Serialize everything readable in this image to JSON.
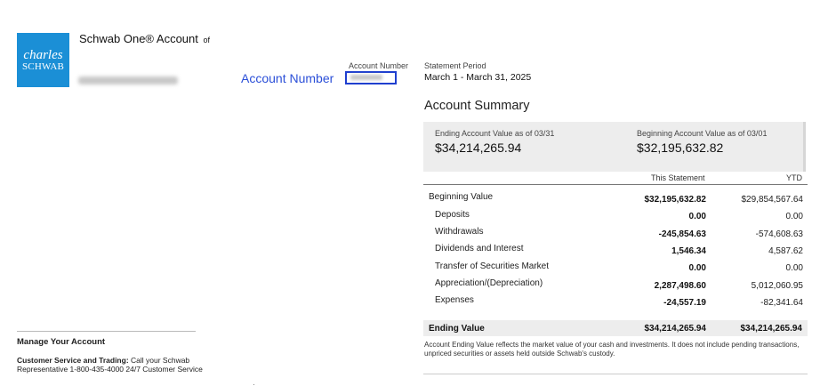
{
  "brand": {
    "logo_line1": "charles",
    "logo_line2": "SCHWAB",
    "logo_color": "#1b8fd6"
  },
  "account": {
    "title": "Schwab One® Account",
    "of": "of",
    "number_label_large": "Account Number",
    "number_label_small": "Account Number"
  },
  "statement": {
    "period_label": "Statement Period",
    "period_value": "March 1 - March 31, 2025"
  },
  "summary": {
    "title": "Account Summary",
    "ending_label": "Ending Account Value as of 03/31",
    "ending_value": "$34,214,265.94",
    "beginning_label": "Beginning Account Value as of 03/01",
    "beginning_value": "$32,195,632.82",
    "columns": [
      "This Statement",
      "YTD"
    ],
    "rows": [
      {
        "label": "Beginning Value",
        "this": "$32,195,632.82",
        "ytd": "$29,854,567.64"
      },
      {
        "label": "Deposits",
        "this": "0.00",
        "ytd": "0.00"
      },
      {
        "label": "Withdrawals",
        "this": "-245,854.63",
        "ytd": "-574,608.63"
      },
      {
        "label": "Dividends and Interest",
        "this": "1,546.34",
        "ytd": "4,587.62"
      },
      {
        "label": "Transfer of Securities Market",
        "this": "0.00",
        "ytd": "0.00"
      },
      {
        "label": "Appreciation/(Depreciation)",
        "this": "2,287,498.60",
        "ytd": "5,012,060.95"
      },
      {
        "label": "Expenses",
        "this": "-24,557.19",
        "ytd": "-82,341.64"
      }
    ],
    "ending_row": {
      "label": "Ending Value",
      "this": "$34,214,265.94",
      "ytd": "$34,214,265.94"
    },
    "footnote": "Account Ending Value reflects the market value of your cash and investments.  It does not include pending transactions, unpriced securities or assets held outside Schwab's custody."
  },
  "manage": {
    "title": "Manage Your Account",
    "cs_bold": "Customer Service and Trading:",
    "cs_text": " Call your Schwab Representative 1-800-435-4000 24/7 Customer Service"
  },
  "colors": {
    "account_number_blue": "#2b4fd8",
    "highlight_box": "#1f3fcf",
    "summary_band": "#ededed"
  }
}
